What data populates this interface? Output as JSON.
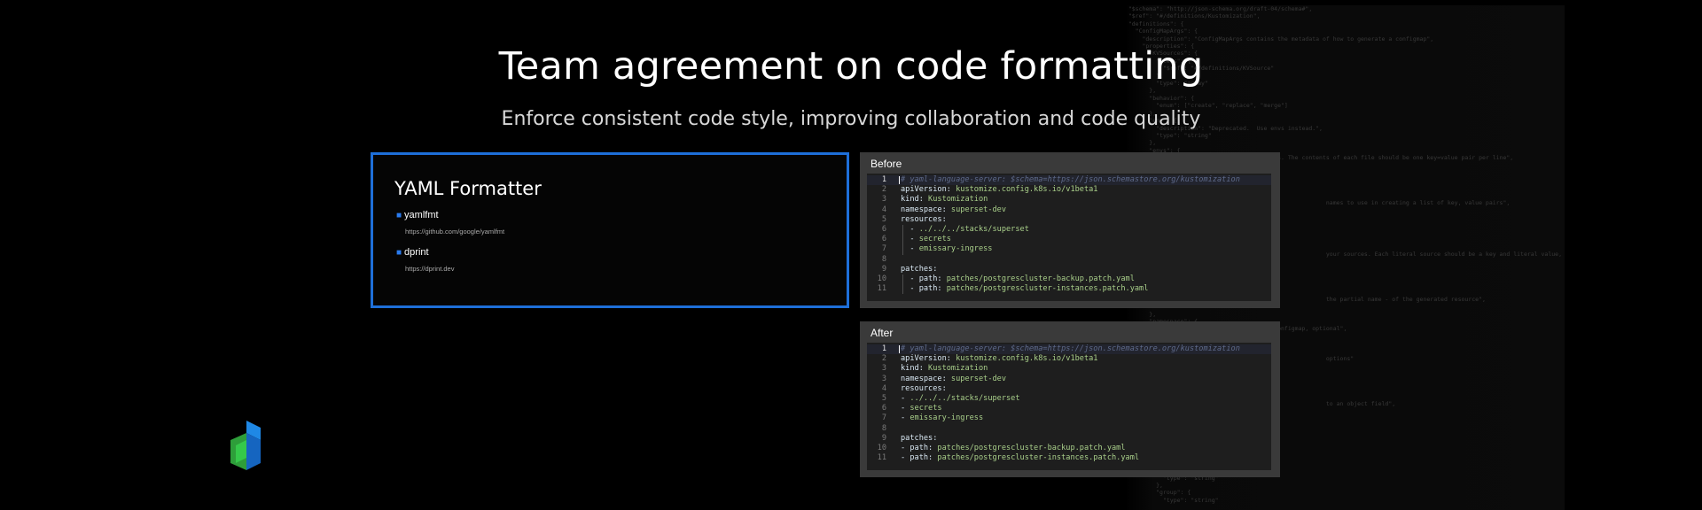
{
  "title": "Team agreement on code formatting",
  "subtitle": "Enforce consistent code style, improving collaboration and code quality",
  "card": {
    "title": "YAML Formatter",
    "items": [
      {
        "name": "yamlfmt",
        "link": "https://github.com/google/yamlfmt"
      },
      {
        "name": "dprint",
        "link": "https://dprint.dev"
      }
    ]
  },
  "before": {
    "label": "Before",
    "lines": [
      {
        "n": "1",
        "parts": [
          {
            "c": "comment",
            "t": "# yaml-language-server: $schema=https://json.schemastore.org/kustomization"
          }
        ]
      },
      {
        "n": "2",
        "parts": [
          {
            "c": "key",
            "t": "apiVersion: "
          },
          {
            "c": "val",
            "t": "kustomize.config.k8s.io/v1beta1"
          }
        ]
      },
      {
        "n": "3",
        "parts": [
          {
            "c": "key",
            "t": "kind: "
          },
          {
            "c": "val",
            "t": "Kustomization"
          }
        ]
      },
      {
        "n": "4",
        "parts": [
          {
            "c": "key",
            "t": "namespace: "
          },
          {
            "c": "val",
            "t": "superset-dev"
          }
        ]
      },
      {
        "n": "5",
        "parts": [
          {
            "c": "key",
            "t": "resources:"
          }
        ]
      },
      {
        "n": "6",
        "parts": [
          {
            "c": "dash",
            "t": "  - "
          },
          {
            "c": "val",
            "t": "../../../stacks/superset"
          }
        ]
      },
      {
        "n": "6",
        "parts": [
          {
            "c": "dash",
            "t": "  - "
          },
          {
            "c": "val",
            "t": "secrets"
          }
        ]
      },
      {
        "n": "7",
        "parts": [
          {
            "c": "dash",
            "t": "  - "
          },
          {
            "c": "val",
            "t": "emissary-ingress"
          }
        ]
      },
      {
        "n": "8",
        "parts": []
      },
      {
        "n": "9",
        "parts": [
          {
            "c": "key",
            "t": "patches:"
          }
        ]
      },
      {
        "n": "10",
        "parts": [
          {
            "c": "dash",
            "t": "  - "
          },
          {
            "c": "key",
            "t": "path: "
          },
          {
            "c": "val",
            "t": "patches/postgrescluster-backup.patch.yaml"
          }
        ]
      },
      {
        "n": "11",
        "parts": [
          {
            "c": "dash",
            "t": "  - "
          },
          {
            "c": "key",
            "t": "path: "
          },
          {
            "c": "val",
            "t": "patches/postgrescluster-instances.patch.yaml"
          }
        ]
      }
    ]
  },
  "after": {
    "label": "After",
    "lines": [
      {
        "n": "1",
        "parts": [
          {
            "c": "comment",
            "t": "# yaml-language-server: $schema=https://json.schemastore.org/kustomization"
          }
        ]
      },
      {
        "n": "2",
        "parts": [
          {
            "c": "key",
            "t": "apiVersion: "
          },
          {
            "c": "val",
            "t": "kustomize.config.k8s.io/v1beta1"
          }
        ]
      },
      {
        "n": "3",
        "parts": [
          {
            "c": "key",
            "t": "kind: "
          },
          {
            "c": "val",
            "t": "Kustomization"
          }
        ]
      },
      {
        "n": "3",
        "parts": [
          {
            "c": "key",
            "t": "namespace: "
          },
          {
            "c": "val",
            "t": "superset-dev"
          }
        ]
      },
      {
        "n": "4",
        "parts": [
          {
            "c": "key",
            "t": "resources:"
          }
        ]
      },
      {
        "n": "5",
        "parts": [
          {
            "c": "dash",
            "t": "- "
          },
          {
            "c": "val",
            "t": "../../../stacks/superset"
          }
        ]
      },
      {
        "n": "6",
        "parts": [
          {
            "c": "dash",
            "t": "- "
          },
          {
            "c": "val",
            "t": "secrets"
          }
        ]
      },
      {
        "n": "7",
        "parts": [
          {
            "c": "dash",
            "t": "- "
          },
          {
            "c": "val",
            "t": "emissary-ingress"
          }
        ]
      },
      {
        "n": "8",
        "parts": []
      },
      {
        "n": "9",
        "parts": [
          {
            "c": "key",
            "t": "patches:"
          }
        ]
      },
      {
        "n": "10",
        "parts": [
          {
            "c": "dash",
            "t": "- "
          },
          {
            "c": "key",
            "t": "path: "
          },
          {
            "c": "val",
            "t": "patches/postgrescluster-backup.patch.yaml"
          }
        ]
      },
      {
        "n": "11",
        "parts": [
          {
            "c": "dash",
            "t": "- "
          },
          {
            "c": "key",
            "t": "path: "
          },
          {
            "c": "val",
            "t": "patches/postgrescluster-instances.patch.yaml"
          }
        ]
      }
    ]
  },
  "background_code": "  \"$schema\": \"http://json-schema.org/draft-04/schema#\",\n  \"$ref\": \"#/definitions/Kustomization\",\n  \"definitions\": {\n    \"ConfigMapArgs\": {\n      \"description\": \"ConfigMapArgs contains the metadata of how to generate a configmap\",\n      \"properties\": {\n        \"KVSources\": {\n          \"items\": {\n            \"$ref\": \"#/definitions/KVSource\"\n          },\n          \"type\": \"array\"\n        },\n        \"behavior\": {\n          \"enum\": [\"create\", \"replace\", \"merge\"]\n        },\n        \"env\": {\n          \"description\": \"Deprecated.  Use envs instead.\",\n          \"type\": \"string\"\n        },\n        \"envs\": {\n          \"description\": \"A list of file paths. The contents of each file should be one key=value pair per line\",\n          \"items\": {\n            \"type\": \"string\"\n          },\n\n\n                                                           names to use in creating a list of key, value pairs\",\n\n\n\n\n\n\n                                                           your sources. Each literal source should be a key and literal value, e.g. `key=value`\",\n\n\n\n\n\n                                                           the partial name - of the generated resource\",\n\n        },\n        \"namespace\": {\n          \"description\": \"Namespace for the configmap, optional\",\n          \"type\": \"string\"\n        },\n        \"options\": {\n                                                           options\"\n\n\n\n\n\n                                                           to an object field\",\n\n\n\n\n\n\n\n\n          \"kind\": {\n            \"type\": \"string\"\n          },\n          \"group\": {\n            \"type\": \"string\""
}
